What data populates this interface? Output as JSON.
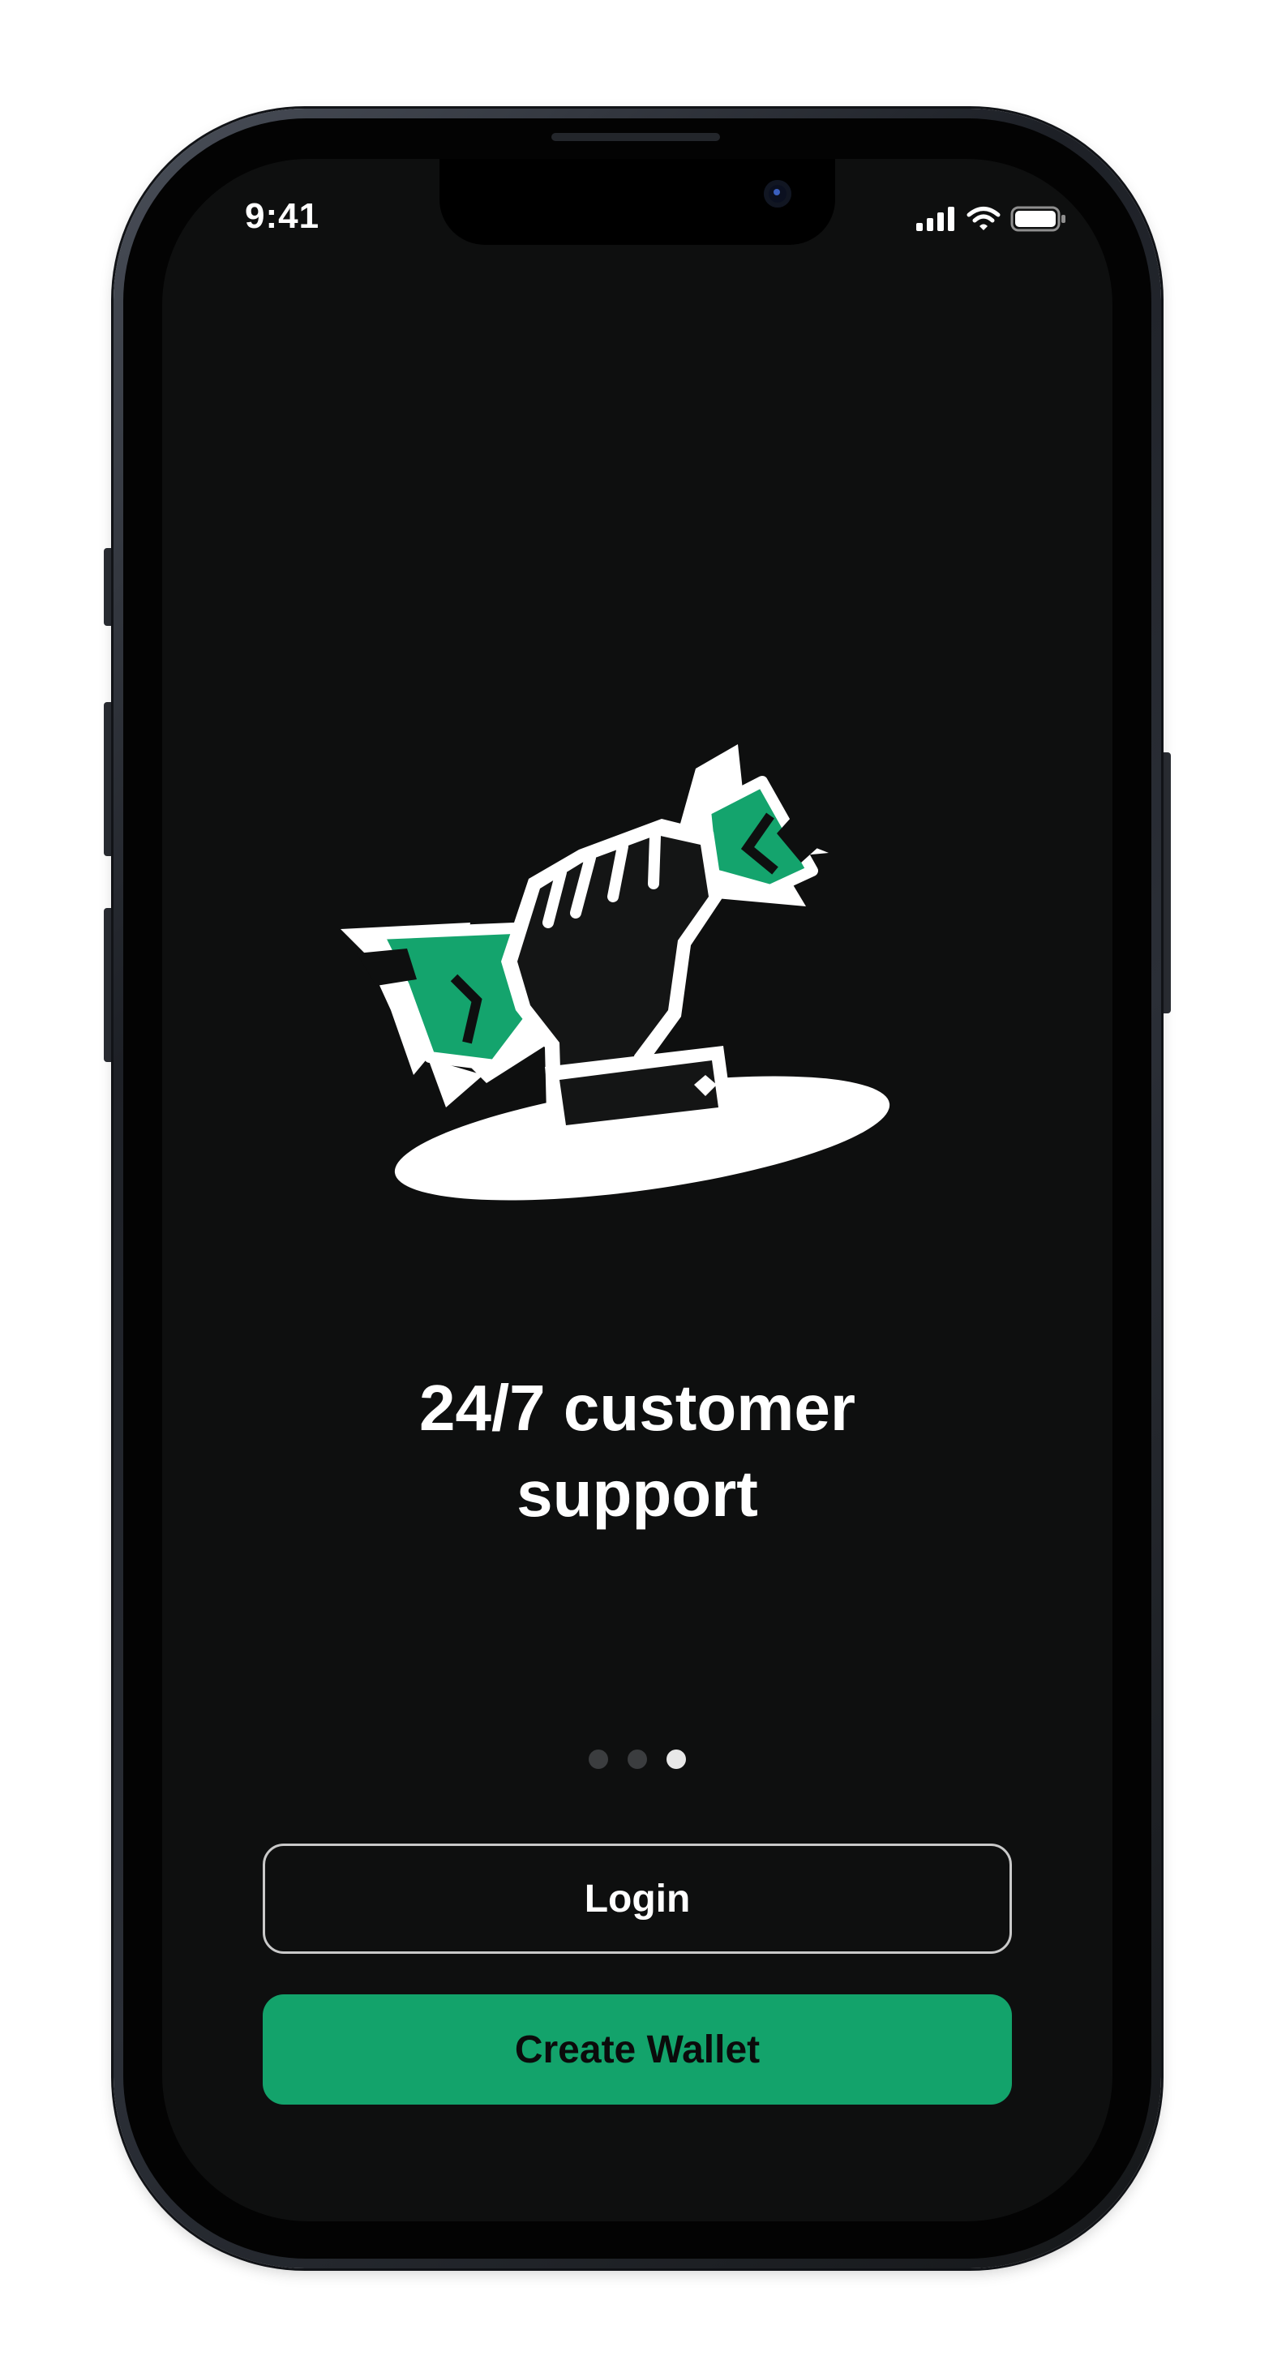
{
  "status_bar": {
    "time": "9:41",
    "icons": [
      "signal-icon",
      "wifi-icon",
      "battery-icon"
    ]
  },
  "onboarding": {
    "illustration": "hand-holding-cash-illustration",
    "title_line1": "24/7 customer",
    "title_line2": "support",
    "page_indicator": {
      "total": 3,
      "current": 3
    }
  },
  "actions": {
    "login_label": "Login",
    "create_wallet_label": "Create Wallet"
  },
  "colors": {
    "background": "#0e0f0f",
    "accent": "#13a36b",
    "text": "#ffffff"
  }
}
